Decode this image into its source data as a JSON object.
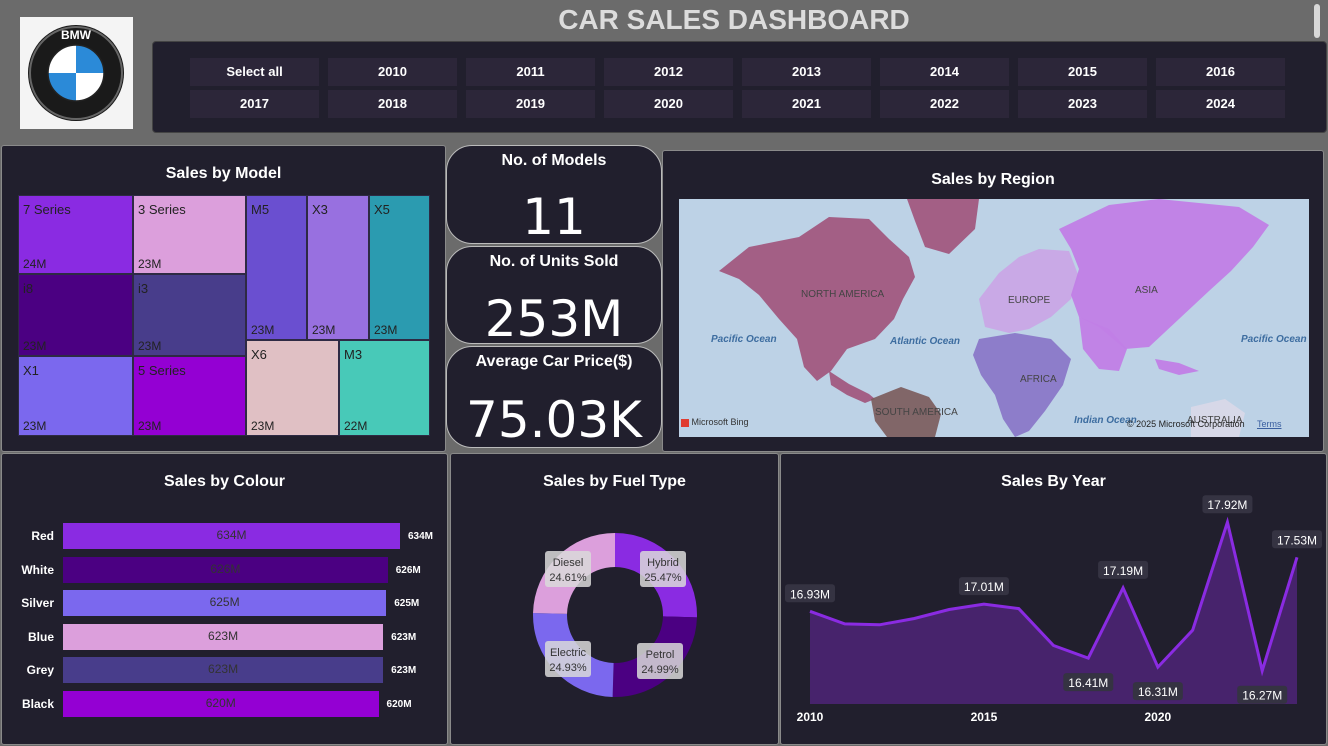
{
  "header": {
    "title": "CAR SALES DASHBOARD",
    "logo_text": "BMW"
  },
  "year_slicer": {
    "items": [
      "Select all",
      "2010",
      "2011",
      "2012",
      "2013",
      "2014",
      "2015",
      "2016",
      "2017",
      "2018",
      "2019",
      "2020",
      "2021",
      "2022",
      "2023",
      "2024"
    ]
  },
  "model_treemap": {
    "title": "Sales by Model",
    "tiles": [
      {
        "name": "7 Series",
        "value": "24M",
        "color": "#8a2be2"
      },
      {
        "name": "3 Series",
        "value": "23M",
        "color": "#dc9fdc"
      },
      {
        "name": "M5",
        "value": "23M",
        "color": "#6a4fd0"
      },
      {
        "name": "X3",
        "value": "23M",
        "color": "#9870e0"
      },
      {
        "name": "X5",
        "value": "23M",
        "color": "#2b9bb0"
      },
      {
        "name": "i8",
        "value": "23M",
        "color": "#4b0082"
      },
      {
        "name": "i3",
        "value": "23M",
        "color": "#483d8b"
      },
      {
        "name": "X6",
        "value": "23M",
        "color": "#e0c0c4"
      },
      {
        "name": "M3",
        "value": "22M",
        "color": "#48c9b8"
      },
      {
        "name": "X1",
        "value": "23M",
        "color": "#7b68ee"
      },
      {
        "name": "5 Series",
        "value": "23M",
        "color": "#9400d3"
      }
    ]
  },
  "kpis": {
    "models": {
      "label": "No. of Models",
      "value": "11"
    },
    "units": {
      "label": "No. of Units Sold",
      "value": "253M"
    },
    "price": {
      "label": "Average Car Price($)",
      "value": "75.03K"
    }
  },
  "region_map": {
    "title": "Sales by Region",
    "regions": [
      "NORTH AMERICA",
      "EUROPE",
      "ASIA",
      "AFRICA",
      "SOUTH AMERICA",
      "AUSTRALIA"
    ],
    "oceans": [
      "Pacific Ocean",
      "Atlantic Ocean",
      "Pacific Ocean",
      "Indian Ocean"
    ],
    "provider": "Microsoft Bing",
    "copyright": "© 2025 Microsoft Corporation",
    "terms": "Terms"
  },
  "colour_chart": {
    "title": "Sales by Colour",
    "bars": [
      {
        "label": "Red",
        "value": 634,
        "text": "634M",
        "color": "#8a2be2"
      },
      {
        "label": "White",
        "value": 626,
        "text": "626M",
        "color": "#4b0082"
      },
      {
        "label": "Silver",
        "value": 625,
        "text": "625M",
        "color": "#7b68ee"
      },
      {
        "label": "Blue",
        "value": 623,
        "text": "623M",
        "color": "#dc9fdc"
      },
      {
        "label": "Grey",
        "value": 623,
        "text": "623M",
        "color": "#483d8b"
      },
      {
        "label": "Black",
        "value": 620,
        "text": "620M",
        "color": "#9400d3"
      }
    ]
  },
  "fuel_chart": {
    "title": "Sales by Fuel Type",
    "slices": [
      {
        "name": "Hybrid",
        "pct": 25.47,
        "text": "25.47%",
        "color": "#8a2be2"
      },
      {
        "name": "Petrol",
        "pct": 24.99,
        "text": "24.99%",
        "color": "#4b0082"
      },
      {
        "name": "Electric",
        "pct": 24.93,
        "text": "24.93%",
        "color": "#7b68ee"
      },
      {
        "name": "Diesel",
        "pct": 24.61,
        "text": "24.61%",
        "color": "#dc9fdc"
      }
    ]
  },
  "chart_data": {
    "type": "area",
    "title": "Sales By Year",
    "x": [
      2010,
      2011,
      2012,
      2013,
      2014,
      2015,
      2016,
      2017,
      2018,
      2019,
      2020,
      2021,
      2022,
      2023,
      2024
    ],
    "values": [
      16.93,
      16.79,
      16.78,
      16.85,
      16.95,
      17.01,
      16.96,
      16.55,
      16.41,
      17.19,
      16.31,
      16.72,
      17.92,
      16.27,
      17.53
    ],
    "data_labels": [
      {
        "i": 0,
        "text": "16.93M"
      },
      {
        "i": 5,
        "text": "17.01M"
      },
      {
        "i": 8,
        "text": "16.41M"
      },
      {
        "i": 9,
        "text": "17.19M"
      },
      {
        "i": 10,
        "text": "16.31M"
      },
      {
        "i": 12,
        "text": "17.92M"
      },
      {
        "i": 13,
        "text": "16.27M"
      },
      {
        "i": 14,
        "text": "17.53M"
      }
    ],
    "x_ticks": [
      "2010",
      "2015",
      "2020"
    ],
    "ylim": [
      15.9,
      18.0
    ],
    "color": "#8a2be2"
  }
}
